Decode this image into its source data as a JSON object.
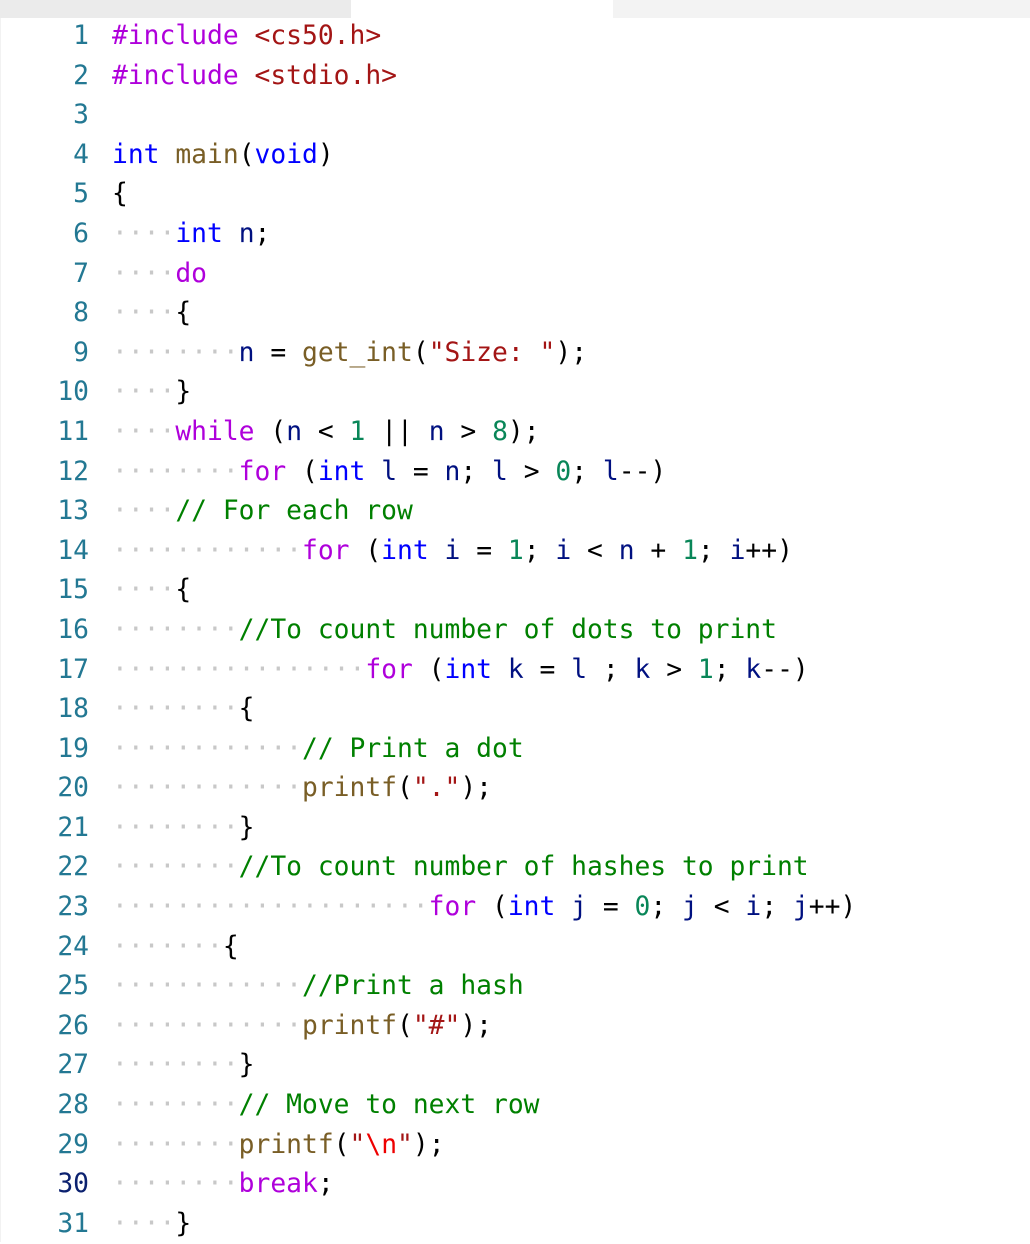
{
  "editor": {
    "language": "c",
    "active_line": 30,
    "whitespace_glyph": "·",
    "colors": {
      "keyword": "#af00db",
      "type": "#0000ff",
      "variable": "#001080",
      "function": "#795e26",
      "string": "#a31515",
      "escape": "#ee0000",
      "number": "#098658",
      "comment": "#008000",
      "line_number": "#237893",
      "active_line_number": "#0b216f"
    },
    "lines": [
      {
        "n": 1,
        "indent": 0,
        "tokens": [
          [
            "kw",
            "#include"
          ],
          [
            "pun",
            " "
          ],
          [
            "str",
            "<cs50.h>"
          ]
        ]
      },
      {
        "n": 2,
        "indent": 0,
        "tokens": [
          [
            "kw",
            "#include"
          ],
          [
            "pun",
            " "
          ],
          [
            "str",
            "<stdio.h>"
          ]
        ]
      },
      {
        "n": 3,
        "indent": 0,
        "tokens": []
      },
      {
        "n": 4,
        "indent": 0,
        "tokens": [
          [
            "type",
            "int"
          ],
          [
            "pun",
            " "
          ],
          [
            "fn",
            "main"
          ],
          [
            "pun",
            "("
          ],
          [
            "type",
            "void"
          ],
          [
            "pun",
            ")"
          ]
        ]
      },
      {
        "n": 5,
        "indent": 0,
        "tokens": [
          [
            "pun",
            "{"
          ]
        ]
      },
      {
        "n": 6,
        "indent": 4,
        "tokens": [
          [
            "type",
            "int"
          ],
          [
            "pun",
            " "
          ],
          [
            "var",
            "n"
          ],
          [
            "pun",
            ";"
          ]
        ]
      },
      {
        "n": 7,
        "indent": 4,
        "tokens": [
          [
            "kw",
            "do"
          ]
        ]
      },
      {
        "n": 8,
        "indent": 4,
        "tokens": [
          [
            "pun",
            "{"
          ]
        ]
      },
      {
        "n": 9,
        "indent": 8,
        "tokens": [
          [
            "var",
            "n"
          ],
          [
            "op",
            " = "
          ],
          [
            "fn",
            "get_int"
          ],
          [
            "pun",
            "("
          ],
          [
            "str",
            "\"Size: \""
          ],
          [
            "pun",
            ");"
          ]
        ]
      },
      {
        "n": 10,
        "indent": 4,
        "tokens": [
          [
            "pun",
            "}"
          ]
        ]
      },
      {
        "n": 11,
        "indent": 4,
        "tokens": [
          [
            "kw",
            "while"
          ],
          [
            "pun",
            " ("
          ],
          [
            "var",
            "n"
          ],
          [
            "op",
            " < "
          ],
          [
            "num",
            "1"
          ],
          [
            "op",
            " || "
          ],
          [
            "var",
            "n"
          ],
          [
            "op",
            " > "
          ],
          [
            "num",
            "8"
          ],
          [
            "pun",
            ");"
          ]
        ]
      },
      {
        "n": 12,
        "indent": 8,
        "tokens": [
          [
            "kw",
            "for"
          ],
          [
            "pun",
            " ("
          ],
          [
            "type",
            "int"
          ],
          [
            "pun",
            " "
          ],
          [
            "var",
            "l"
          ],
          [
            "op",
            " = "
          ],
          [
            "var",
            "n"
          ],
          [
            "pun",
            "; "
          ],
          [
            "var",
            "l"
          ],
          [
            "op",
            " > "
          ],
          [
            "num",
            "0"
          ],
          [
            "pun",
            "; "
          ],
          [
            "var",
            "l"
          ],
          [
            "op",
            "--"
          ],
          [
            "pun",
            ")"
          ]
        ]
      },
      {
        "n": 13,
        "indent": 4,
        "tokens": [
          [
            "com",
            "// For each row"
          ]
        ]
      },
      {
        "n": 14,
        "indent": 12,
        "tokens": [
          [
            "kw",
            "for"
          ],
          [
            "pun",
            " ("
          ],
          [
            "type",
            "int"
          ],
          [
            "pun",
            " "
          ],
          [
            "var",
            "i"
          ],
          [
            "op",
            " = "
          ],
          [
            "num",
            "1"
          ],
          [
            "pun",
            "; "
          ],
          [
            "var",
            "i"
          ],
          [
            "op",
            " < "
          ],
          [
            "var",
            "n"
          ],
          [
            "op",
            " + "
          ],
          [
            "num",
            "1"
          ],
          [
            "pun",
            "; "
          ],
          [
            "var",
            "i"
          ],
          [
            "op",
            "++"
          ],
          [
            "pun",
            ")"
          ]
        ]
      },
      {
        "n": 15,
        "indent": 4,
        "tokens": [
          [
            "pun",
            "{"
          ]
        ]
      },
      {
        "n": 16,
        "indent": 8,
        "tokens": [
          [
            "com",
            "//To count number of dots to print"
          ]
        ]
      },
      {
        "n": 17,
        "indent": 16,
        "tokens": [
          [
            "kw",
            "for"
          ],
          [
            "pun",
            " ("
          ],
          [
            "type",
            "int"
          ],
          [
            "pun",
            " "
          ],
          [
            "var",
            "k"
          ],
          [
            "op",
            " = "
          ],
          [
            "var",
            "l"
          ],
          [
            "pun",
            " ; "
          ],
          [
            "var",
            "k"
          ],
          [
            "op",
            " > "
          ],
          [
            "num",
            "1"
          ],
          [
            "pun",
            "; "
          ],
          [
            "var",
            "k"
          ],
          [
            "op",
            "--"
          ],
          [
            "pun",
            ")"
          ]
        ]
      },
      {
        "n": 18,
        "indent": 8,
        "tokens": [
          [
            "pun",
            "{"
          ]
        ]
      },
      {
        "n": 19,
        "indent": 12,
        "tokens": [
          [
            "com",
            "// Print a dot"
          ]
        ]
      },
      {
        "n": 20,
        "indent": 12,
        "tokens": [
          [
            "fn",
            "printf"
          ],
          [
            "pun",
            "("
          ],
          [
            "str",
            "\".\""
          ],
          [
            "pun",
            ");"
          ]
        ]
      },
      {
        "n": 21,
        "indent": 8,
        "tokens": [
          [
            "pun",
            "}"
          ]
        ]
      },
      {
        "n": 22,
        "indent": 8,
        "tokens": [
          [
            "com",
            "//To count number of hashes to print"
          ]
        ]
      },
      {
        "n": 23,
        "indent": 20,
        "tokens": [
          [
            "kw",
            "for"
          ],
          [
            "pun",
            " ("
          ],
          [
            "type",
            "int"
          ],
          [
            "pun",
            " "
          ],
          [
            "var",
            "j"
          ],
          [
            "op",
            " = "
          ],
          [
            "num",
            "0"
          ],
          [
            "pun",
            "; "
          ],
          [
            "var",
            "j"
          ],
          [
            "op",
            " < "
          ],
          [
            "var",
            "i"
          ],
          [
            "pun",
            "; "
          ],
          [
            "var",
            "j"
          ],
          [
            "op",
            "++"
          ],
          [
            "pun",
            ")"
          ]
        ]
      },
      {
        "n": 24,
        "indent": 7,
        "tokens": [
          [
            "pun",
            "{"
          ]
        ]
      },
      {
        "n": 25,
        "indent": 12,
        "tokens": [
          [
            "com",
            "//Print a hash"
          ]
        ]
      },
      {
        "n": 26,
        "indent": 12,
        "tokens": [
          [
            "fn",
            "printf"
          ],
          [
            "pun",
            "("
          ],
          [
            "str",
            "\"#\""
          ],
          [
            "pun",
            ");"
          ]
        ]
      },
      {
        "n": 27,
        "indent": 8,
        "tokens": [
          [
            "pun",
            "}"
          ]
        ]
      },
      {
        "n": 28,
        "indent": 8,
        "tokens": [
          [
            "com",
            "// Move to next row"
          ]
        ]
      },
      {
        "n": 29,
        "indent": 8,
        "tokens": [
          [
            "fn",
            "printf"
          ],
          [
            "pun",
            "("
          ],
          [
            "str",
            "\""
          ],
          [
            "esc",
            "\\n"
          ],
          [
            "str",
            "\""
          ],
          [
            "pun",
            ");"
          ]
        ]
      },
      {
        "n": 30,
        "indent": 8,
        "tokens": [
          [
            "kw",
            "break"
          ],
          [
            "pun",
            ";"
          ]
        ]
      },
      {
        "n": 31,
        "indent": 4,
        "tokens": [
          [
            "pun",
            "}"
          ]
        ]
      }
    ]
  }
}
